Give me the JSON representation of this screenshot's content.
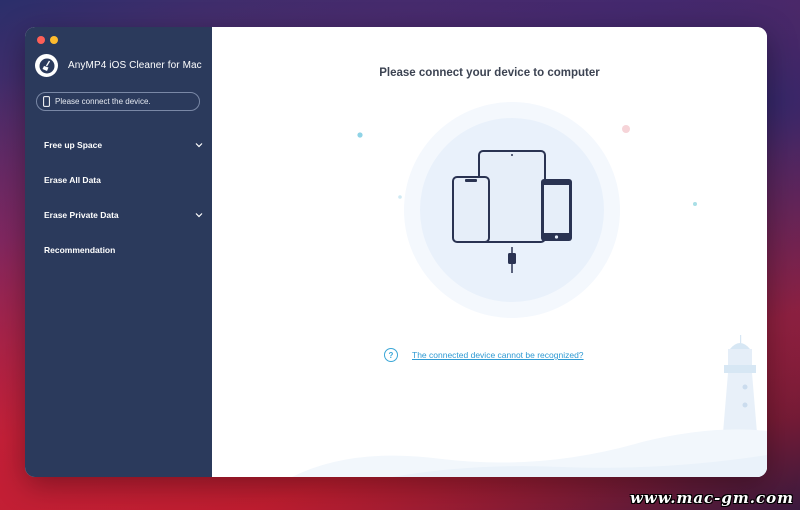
{
  "app": {
    "title": "AnyMP4 iOS Cleaner for Mac"
  },
  "sidebar": {
    "device_status": "Please connect the device.",
    "items": [
      {
        "label": "Free up Space",
        "expandable": true
      },
      {
        "label": "Erase All Data",
        "expandable": false
      },
      {
        "label": "Erase Private Data",
        "expandable": true
      },
      {
        "label": "Recommendation",
        "expandable": false
      }
    ]
  },
  "main": {
    "heading": "Please connect your device to computer",
    "help_link": "The connected device cannot be recognized?",
    "help_icon_glyph": "?"
  },
  "watermark": "www.mac-gm.com",
  "colors": {
    "sidebar_bg": "#2b3a5c",
    "link": "#2f9ad3",
    "heading": "#3c4352"
  }
}
